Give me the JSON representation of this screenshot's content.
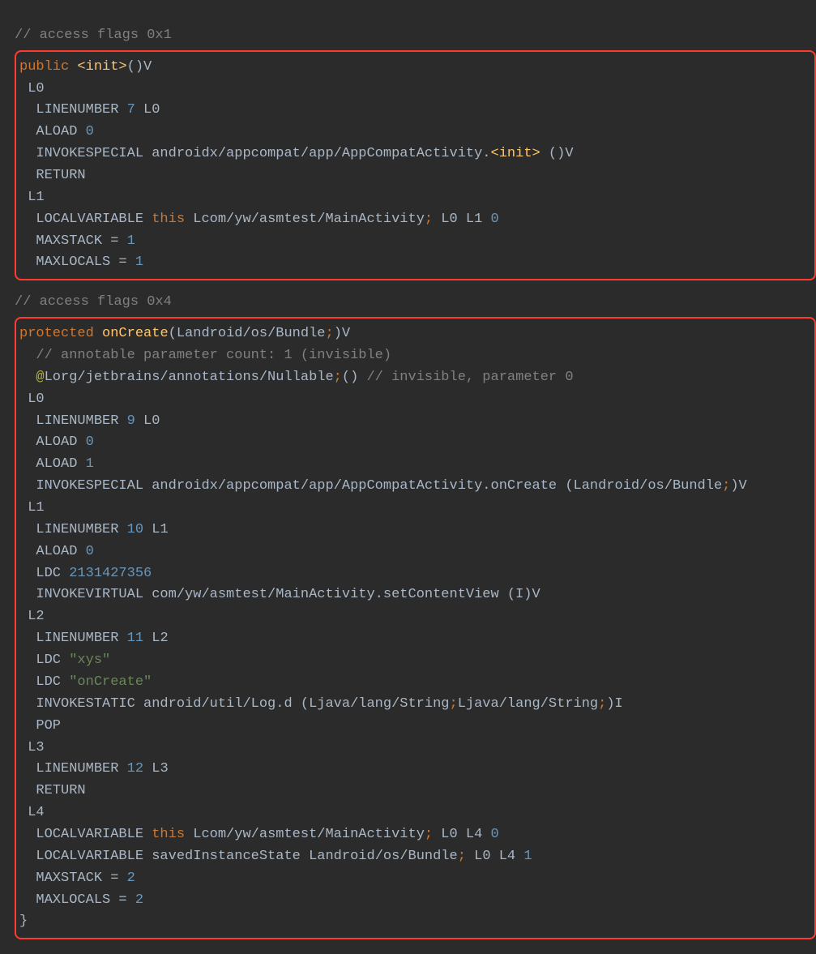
{
  "block1": {
    "c0": "// access flags 0x1",
    "kw": "public",
    "init": "<init>",
    "sig": "()V",
    "l0": "L0",
    "ln": "LINENUMBER",
    "seven": "7",
    "aload": "ALOAD",
    "zero": "0",
    "invokesp": "INVOKESPECIAL",
    "spcall": "androidx/appcompat/app/AppCompatActivity.",
    "spinit": "<init>",
    "sptail": " ()V",
    "ret": "RETURN",
    "l1": "L1",
    "localvar": "LOCALVARIABLE",
    "this": "this",
    "lvtype": "Lcom/yw/asmtest/MainActivity",
    "semi": ";",
    "lvtail": " L0 L1 ",
    "lvzero": "0",
    "maxstack": "MAXSTACK = ",
    "one": "1",
    "maxlocals": "MAXLOCALS = "
  },
  "block2": {
    "c0": "// access flags 0x4",
    "kw": "protected",
    "meth": "onCreate",
    "sig_a": "(Landroid/os/Bundle",
    "semi": ";",
    "sig_b": ")V",
    "c1": "// annotable parameter count: 1 (invisible)",
    "annotAt": "@",
    "annotPath": "Lorg/jetbrains/annotations/Nullable",
    "annotTail": "()",
    "c2": "// invisible, parameter 0",
    "l0": "L0",
    "ln": "LINENUMBER",
    "nine": "9",
    "aload": "ALOAD",
    "zero": "0",
    "one": "1",
    "invokesp": "INVOKESPECIAL",
    "spcall": "androidx/appcompat/app/AppCompatActivity.onCreate (Landroid/os/Bundle",
    "spcall_b": ")V",
    "l1": "L1",
    "ten": "10",
    "ldc": "LDC",
    "bignum": "2131427356",
    "invokevirt": "INVOKEVIRTUAL",
    "vcall": "com/yw/asmtest/MainActivity.setContentView (I)V",
    "l2": "L2",
    "eleven": "11",
    "str1": "\"xys\"",
    "str2": "\"onCreate\"",
    "invokestatic": "INVOKESTATIC",
    "scall_a": "android/util/Log.d (Ljava/lang/String",
    "scall_b": "Ljava/lang/String",
    "scall_c": ")I",
    "pop": "POP",
    "l3": "L3",
    "twelve": "12",
    "ret": "RETURN",
    "l4": "L4",
    "localvar": "LOCALVARIABLE",
    "this": "this",
    "lvtype1": "Lcom/yw/asmtest/MainActivity",
    "lvtail1": " L0 L4 ",
    "lvzero": "0",
    "lvname2": "savedInstanceState",
    "lvtype2": "Landroid/os/Bundle",
    "lvtail2": " L0 L4 ",
    "lvone": "1",
    "maxstack": "MAXSTACK = ",
    "two": "2",
    "maxlocals": "MAXLOCALS = ",
    "closebrace": "}"
  }
}
